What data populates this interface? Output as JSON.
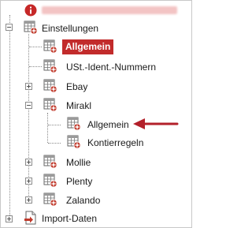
{
  "tree": {
    "root": {
      "label": "",
      "icon": "info-icon"
    },
    "einstellungen": {
      "label": "Einstellungen",
      "expander": "−"
    },
    "allgemein_top": {
      "label": "Allgemein"
    },
    "ust": {
      "label": "USt.-Ident.-Nummern"
    },
    "ebay": {
      "label": "Ebay",
      "expander": "+"
    },
    "mirakl": {
      "label": "Mirakl",
      "expander": "−"
    },
    "mirakl_allgemein": {
      "label": "Allgemein"
    },
    "kontierregeln": {
      "label": "Kontierregeln"
    },
    "mollie": {
      "label": "Mollie",
      "expander": "+"
    },
    "plenty": {
      "label": "Plenty",
      "expander": "+"
    },
    "zalando": {
      "label": "Zalando",
      "expander": "+"
    },
    "import_daten": {
      "label": "Import-Daten",
      "expander": "+"
    }
  },
  "colors": {
    "accent": "#c22b2b",
    "arrow": "#b3202a",
    "tree_lines": "#8a8a8a"
  }
}
